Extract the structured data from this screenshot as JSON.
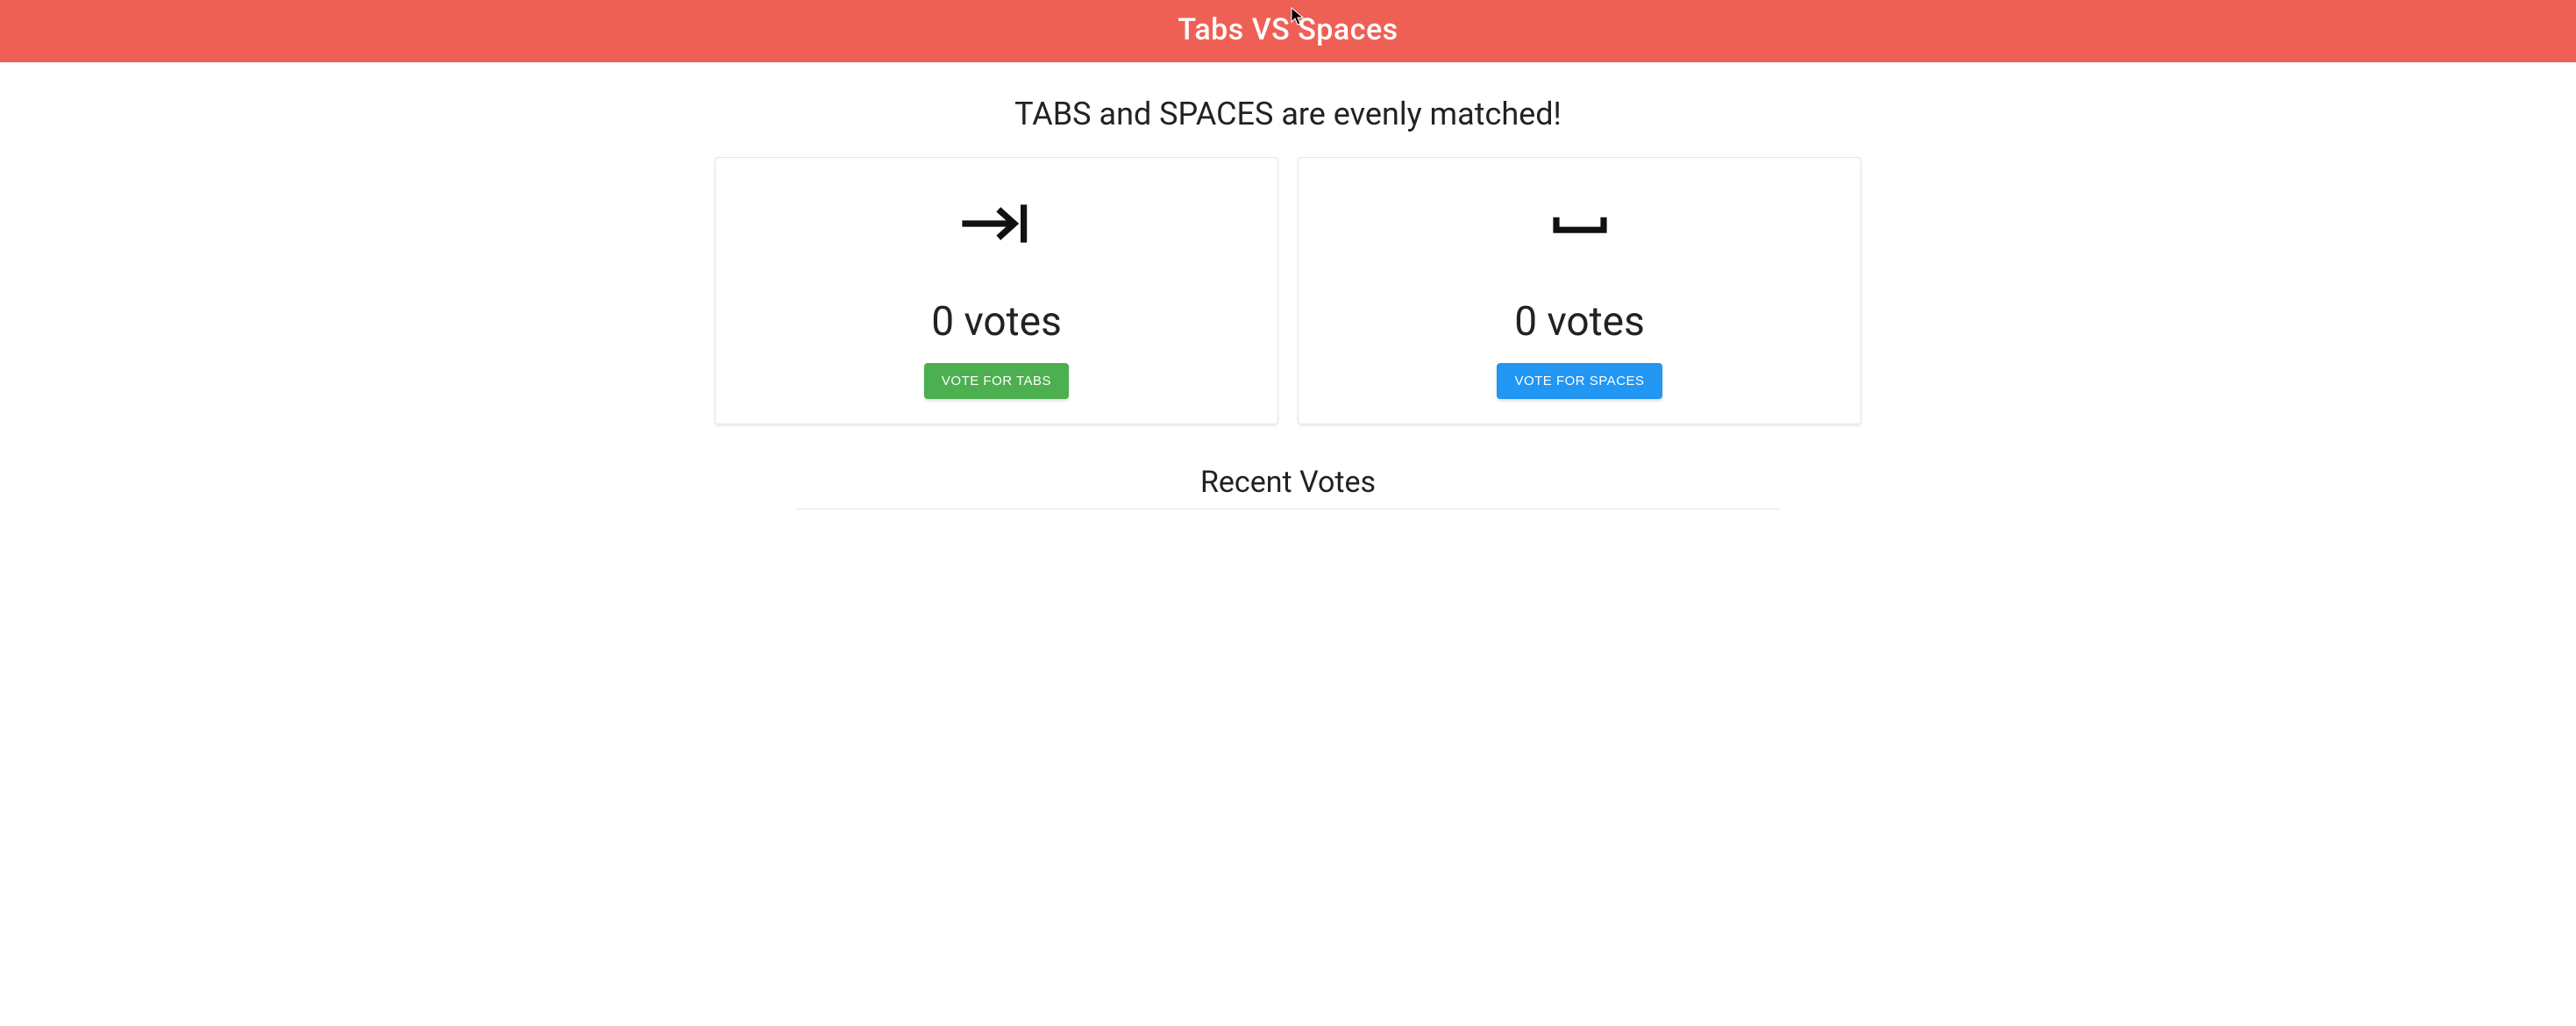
{
  "header": {
    "title": "Tabs VS Spaces"
  },
  "status": {
    "message": "TABS and SPACES are evenly matched!"
  },
  "cards": {
    "tabs": {
      "vote_text": "0 votes",
      "button_label": "VOTE FOR TABS"
    },
    "spaces": {
      "vote_text": "0 votes",
      "button_label": "VOTE FOR SPACES"
    }
  },
  "recent": {
    "title": "Recent Votes"
  },
  "colors": {
    "header_bg": "#ee6055",
    "btn_green": "#4caf50",
    "btn_blue": "#2196f3"
  }
}
